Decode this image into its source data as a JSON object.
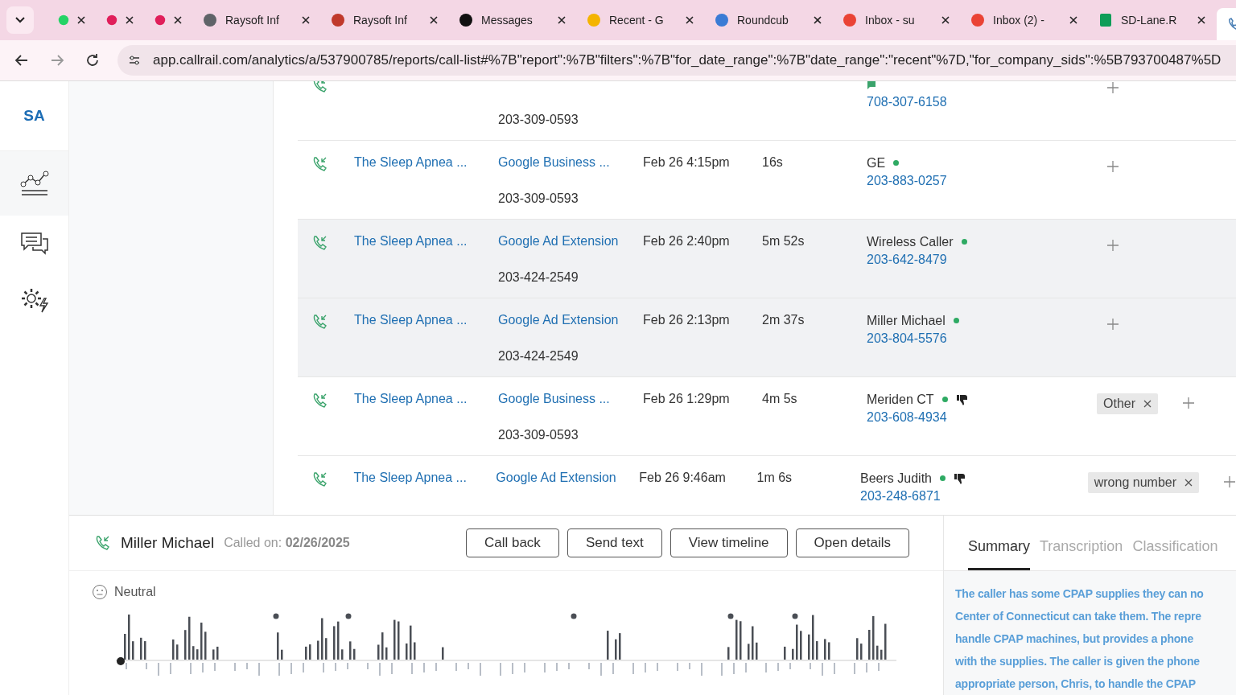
{
  "browser": {
    "tabs": [
      {
        "selected": false
      },
      {
        "selected": false
      },
      {
        "selected": false
      },
      {
        "title": "Raysoft Inf",
        "selected": false
      },
      {
        "title": "Raysoft Inf",
        "selected": false
      },
      {
        "title": "Messages",
        "selected": false
      },
      {
        "title": "Recent - G",
        "selected": false
      },
      {
        "title": "Roundcub",
        "selected": false
      },
      {
        "title": "Inbox - su",
        "selected": false
      },
      {
        "title": "Inbox (2) -",
        "selected": false
      },
      {
        "title": "SD-Lane.R",
        "selected": false
      },
      {
        "selected": true
      }
    ],
    "url": "app.callrail.com/analytics/a/537900785/reports/call-list#%7B\"report\":%7B\"filters\":%7B\"for_date_range\":%7B\"date_range\":\"recent\"%7D,\"for_company_sids\":%5B793700487%5D"
  },
  "sidebar": {
    "account": "SA",
    "items": [
      {
        "selected": true
      },
      {
        "selected": false
      },
      {
        "selected": false
      }
    ]
  },
  "calls": [
    {
      "tracking_number": "203-309-0593",
      "caller_number": "708-307-6158",
      "kind": "message",
      "highlighted": false
    },
    {
      "company": "The Sleep Apnea ...",
      "source": "Google Business ...",
      "tracking_number": "203-309-0593",
      "time": "Feb 26 4:15pm",
      "duration": "16s",
      "caller": "GE",
      "caller_number": "203-883-0257",
      "kind": "dot",
      "highlighted": false
    },
    {
      "company": "The Sleep Apnea ...",
      "source": "Google Ad Extension",
      "tracking_number": "203-424-2549",
      "time": "Feb 26 2:40pm",
      "duration": "5m 52s",
      "caller": "Wireless Caller",
      "caller_number": "203-642-8479",
      "kind": "dot",
      "highlighted": true
    },
    {
      "company": "The Sleep Apnea ...",
      "source": "Google Ad Extension",
      "tracking_number": "203-424-2549",
      "time": "Feb 26 2:13pm",
      "duration": "2m 37s",
      "caller": "Miller Michael",
      "caller_number": "203-804-5576",
      "kind": "dot",
      "highlighted": true
    },
    {
      "company": "The Sleep Apnea ...",
      "source": "Google Business ...",
      "tracking_number": "203-309-0593",
      "time": "Feb 26 1:29pm",
      "duration": "4m 5s",
      "caller": "Meriden CT",
      "caller_number": "203-608-4934",
      "kind": "thumbs_down",
      "tags": [
        "Other"
      ],
      "highlighted": false
    },
    {
      "company": "The Sleep Apnea ...",
      "source": "Google Ad Extension",
      "time": "Feb 26 9:46am",
      "duration": "1m 6s",
      "caller": "Beers Judith",
      "caller_number": "203-248-6871",
      "kind": "thumbs_down",
      "tags": [
        "wrong number"
      ],
      "highlighted": false
    }
  ],
  "detail": {
    "caller": "Miller Michael",
    "called_on": "Called on: **02/26/2025**",
    "buttons": [
      "Call back",
      "Send text",
      "View timeline",
      "Open details"
    ],
    "sentiment": "Neutral",
    "tabs": [
      {
        "label": "Summary",
        "selected": true
      },
      {
        "label": "Transcription",
        "selected": false
      },
      {
        "label": "Classification",
        "selected": false
      }
    ],
    "summary_lines": [
      "The caller has some CPAP supplies they can no",
      "Center of Connecticut can take them. The repre",
      "handle CPAP machines, but provides a phone",
      "with the supplies. The caller is given the phone",
      "appropriate person, Chris, to handle the CPAP"
    ]
  }
}
